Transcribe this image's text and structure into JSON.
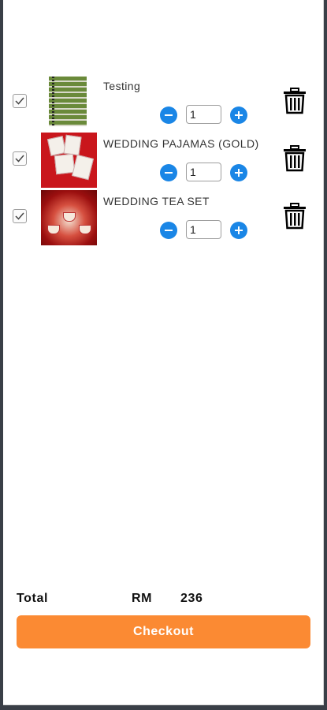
{
  "cart": {
    "items": [
      {
        "name": "Testing",
        "quantity": "1",
        "checked": true,
        "image": "memory-board"
      },
      {
        "name": "WEDDING PAJAMAS (GOLD)",
        "quantity": "1",
        "checked": true,
        "image": "red-pajamas"
      },
      {
        "name": "WEDDING TEA SET",
        "quantity": "1",
        "checked": true,
        "image": "red-tea-set"
      }
    ]
  },
  "summary": {
    "total_label": "Total",
    "currency": "RM",
    "amount": "236"
  },
  "actions": {
    "checkout_label": "Checkout"
  },
  "colors": {
    "accent_blue": "#1a86e6",
    "checkout_orange": "#fb8a33"
  },
  "icons": [
    "checkbox-checked-icon",
    "minus-circle-icon",
    "plus-circle-icon",
    "trash-icon"
  ]
}
